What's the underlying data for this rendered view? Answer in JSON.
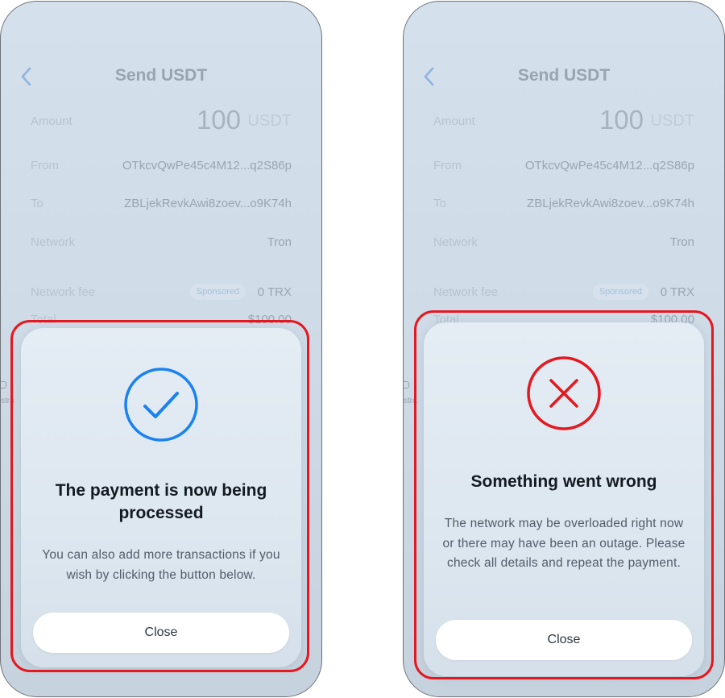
{
  "screens": [
    {
      "header": {
        "title": "Send USDT"
      },
      "rows": {
        "amount_label": "Amount",
        "amount_value": "100",
        "amount_unit": "USDT",
        "from_label": "From",
        "from_value": "OTkcvQwPe45c4M12...q2S86p",
        "to_label": "To",
        "to_value": "ZBLjekRevkAwi8zoev...o9K74h",
        "network_label": "Network",
        "network_value": "Tron",
        "fee_label": "Network fee",
        "fee_badge": "Sponsored",
        "fee_value": "0 TRX",
        "total_label": "Total",
        "total_value": "$100.00"
      },
      "peek_text": "stra",
      "modal": {
        "status": "success",
        "icon": "check-circle-icon",
        "icon_color": "#1a82f0",
        "title": "The payment is now being processed",
        "text": "You can also add more transactions if you wish by clicking the button below.",
        "close_label": "Close"
      }
    },
    {
      "header": {
        "title": "Send USDT"
      },
      "rows": {
        "amount_label": "Amount",
        "amount_value": "100",
        "amount_unit": "USDT",
        "from_label": "From",
        "from_value": "OTkcvQwPe45c4M12...q2S86p",
        "to_label": "To",
        "to_value": "ZBLjekRevkAwi8zoev...o9K74h",
        "network_label": "Network",
        "network_value": "Tron",
        "fee_label": "Network fee",
        "fee_badge": "Sponsored",
        "fee_value": "0 TRX",
        "total_label": "Total",
        "total_value": "$100.00"
      },
      "peek_text": "stra",
      "modal": {
        "status": "error",
        "icon": "error-x-circle-icon",
        "icon_color": "#e5171f",
        "title": "Something went wrong",
        "text": "The network may be overloaded right now or there may have been an outage. Please check all details and repeat the payment.",
        "close_label": "Close"
      }
    }
  ],
  "highlight_color": "#e5171f"
}
